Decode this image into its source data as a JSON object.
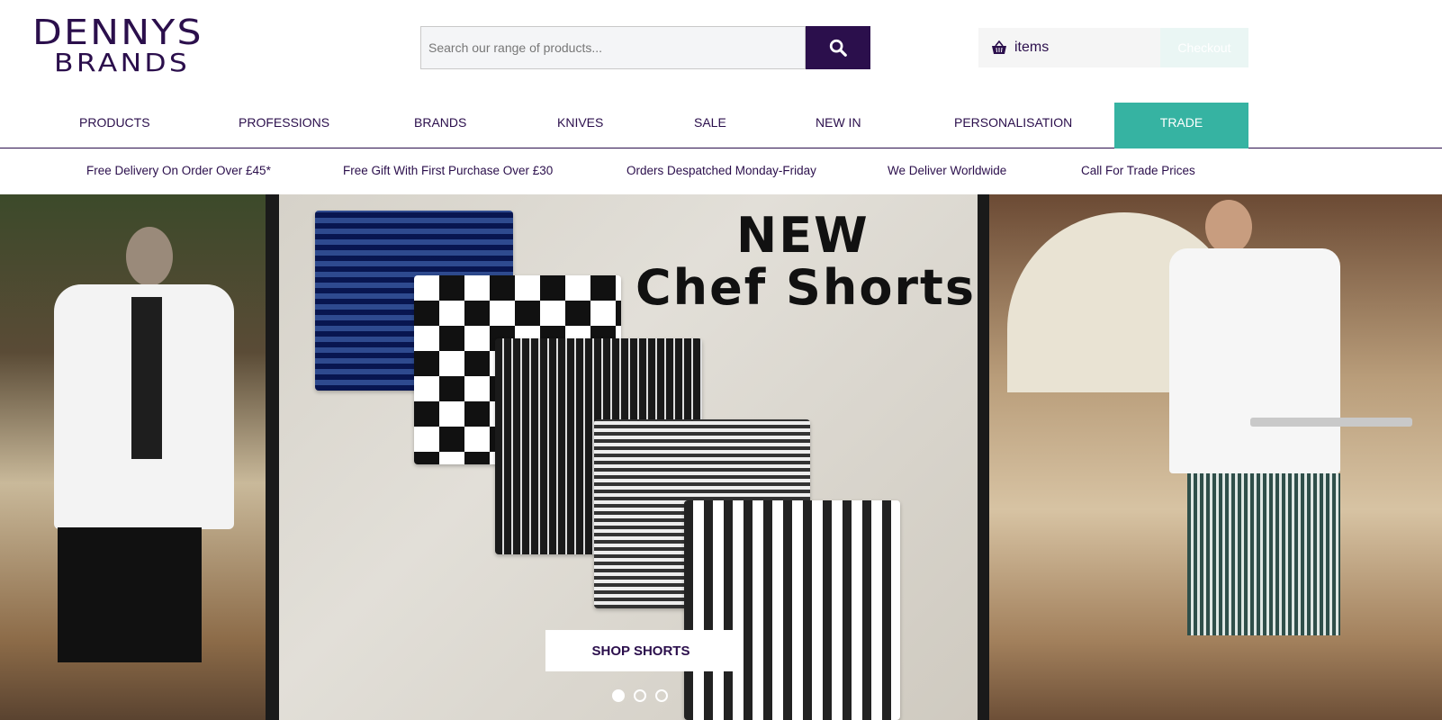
{
  "brand": {
    "line1": "DENNYS",
    "line2": "BRANDS",
    "color": "#2b0f4c"
  },
  "search": {
    "placeholder": "Search our range of products...",
    "icon": "search-icon"
  },
  "basket": {
    "icon": "basket-icon",
    "label": "items",
    "checkout_label": "Checkout"
  },
  "nav": {
    "items": [
      "PRODUCTS",
      "PROFESSIONS",
      "BRANDS",
      "KNIVES",
      "SALE",
      "NEW IN",
      "PERSONALISATION"
    ],
    "trade": "TRADE",
    "trade_color": "#36b3a2"
  },
  "usp": [
    "Free Delivery On Order Over £45*",
    "Free Gift With First Purchase Over £30",
    "Orders Despatched Monday-Friday",
    "We Deliver Worldwide",
    "Call For Trade Prices"
  ],
  "hero": {
    "heading_line1": "NEW",
    "heading_line2": "Chef Shorts",
    "cta": "SHOP SHORTS",
    "slides": 3,
    "active_slide": 1
  }
}
